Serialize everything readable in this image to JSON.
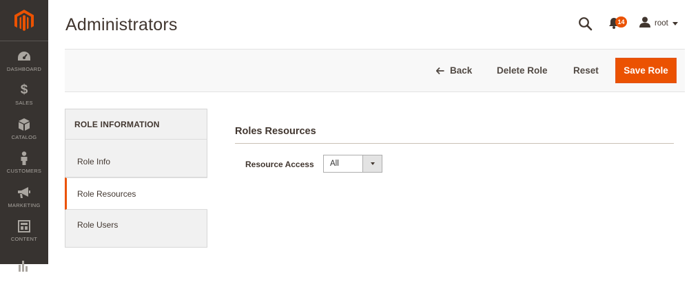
{
  "sidebar": {
    "items": [
      {
        "label": "DASHBOARD",
        "icon": "dashboard-icon"
      },
      {
        "label": "SALES",
        "icon": "dollar-icon"
      },
      {
        "label": "CATALOG",
        "icon": "box-icon"
      },
      {
        "label": "CUSTOMERS",
        "icon": "person-icon"
      },
      {
        "label": "MARKETING",
        "icon": "megaphone-icon"
      },
      {
        "label": "CONTENT",
        "icon": "layout-icon"
      },
      {
        "label": "",
        "icon": "bar-chart-icon"
      }
    ],
    "sales_symbol": "$"
  },
  "header": {
    "title": "Administrators",
    "notifications_count": "14",
    "user_name": "root"
  },
  "actions": {
    "back_label": "Back",
    "delete_label": "Delete Role",
    "reset_label": "Reset",
    "save_label": "Save Role"
  },
  "tabs": {
    "title": "ROLE INFORMATION",
    "items": [
      {
        "label": "Role Info",
        "active": false
      },
      {
        "label": "Role Resources",
        "active": true
      },
      {
        "label": "Role Users",
        "active": false
      }
    ]
  },
  "main": {
    "section_title": "Roles Resources",
    "resource_access_label": "Resource Access",
    "resource_access_value": "All"
  },
  "colors": {
    "accent": "#eb5202",
    "sidebar_bg": "#373330"
  }
}
